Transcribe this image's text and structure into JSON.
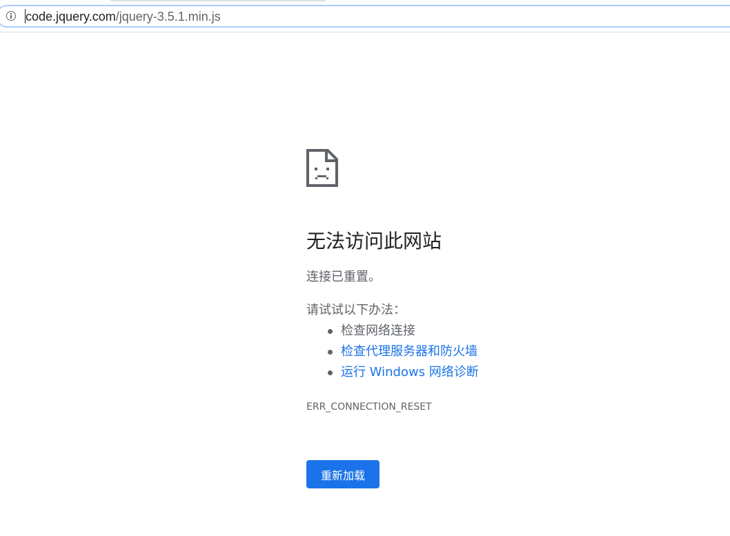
{
  "address_bar": {
    "url_host": "code.jquery.com",
    "url_path": "/jquery-3.5.1.min.js",
    "security_icon": "info-icon"
  },
  "error_page": {
    "icon": "sad-page-icon",
    "title": "无法访问此网站",
    "summary": "连接已重置。",
    "suggestions_heading": "请试试以下办法：",
    "suggestions": [
      {
        "label": "检查网络连接",
        "is_link": false
      },
      {
        "label": "检查代理服务器和防火墙",
        "is_link": true
      },
      {
        "label": "运行 Windows 网络诊断",
        "is_link": true
      }
    ],
    "error_code": "ERR_CONNECTION_RESET",
    "reload_button": "重新加载"
  },
  "colors": {
    "accent": "#1a73e8",
    "text_primary": "#202124",
    "text_secondary": "#5f6368",
    "omnibox_focus": "#aecbfa"
  }
}
